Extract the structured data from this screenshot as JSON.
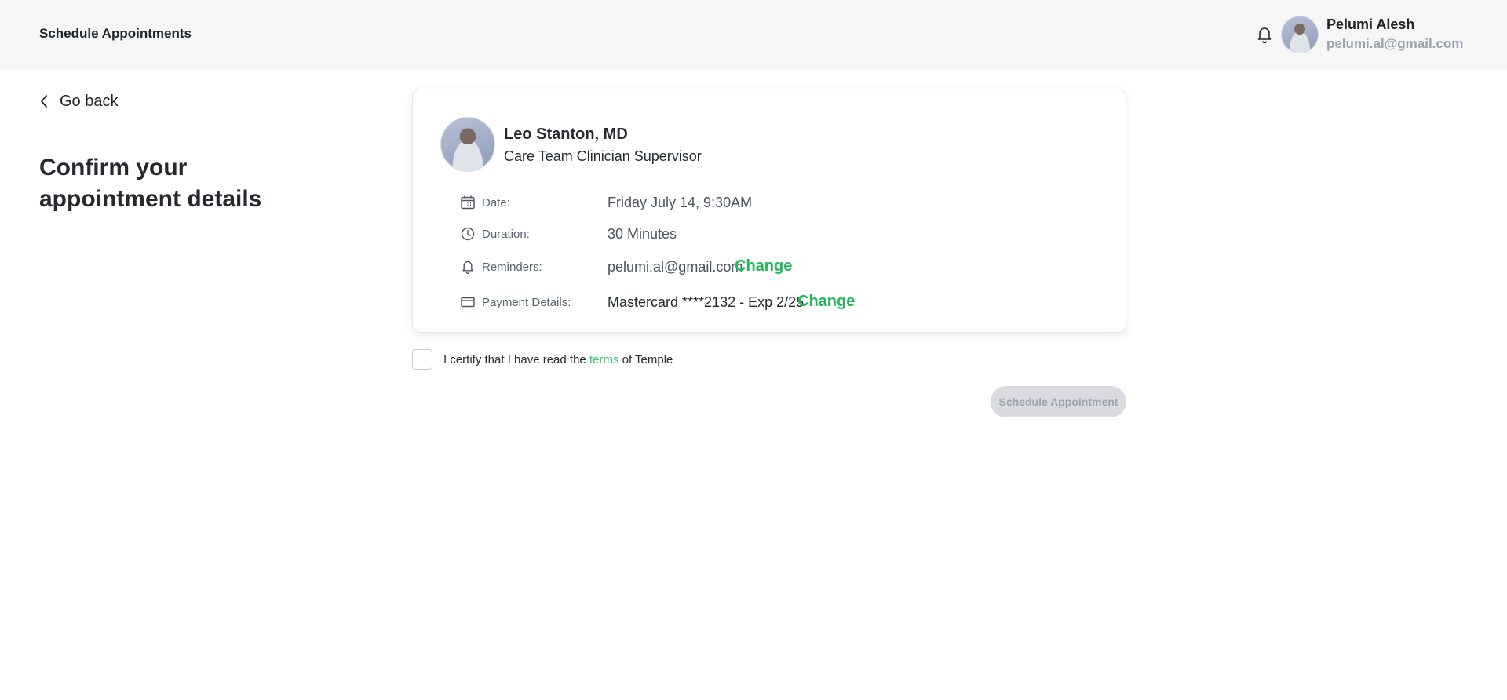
{
  "header": {
    "title": "Schedule Appointments",
    "user": {
      "name": "Pelumi Alesh",
      "email": "pelumi.al@gmail.com"
    }
  },
  "nav": {
    "go_back": "Go back"
  },
  "page": {
    "title": "Confirm your appointment details"
  },
  "doctor": {
    "name": "Leo Stanton, MD",
    "role": "Care Team Clinician Supervisor"
  },
  "details": {
    "date": {
      "label": "Date:",
      "value": "Friday July 14, 9:30AM"
    },
    "duration": {
      "label": "Duration:",
      "value": "30 Minutes"
    },
    "reminders": {
      "label": "Reminders:",
      "value": "pelumi.al@gmail.com",
      "action": "Change"
    },
    "payment": {
      "label": "Payment Details:",
      "value": "Mastercard ****2132 - Exp 2/25",
      "action": "Change"
    }
  },
  "certify": {
    "prefix": "I certify that I have read the ",
    "link": "terms",
    "suffix": " of Temple"
  },
  "actions": {
    "schedule": "Schedule Appointment"
  },
  "colors": {
    "accent": "#22b85a",
    "header_bg": "#f6f6f6",
    "disabled_button": "#d9dbe0"
  }
}
